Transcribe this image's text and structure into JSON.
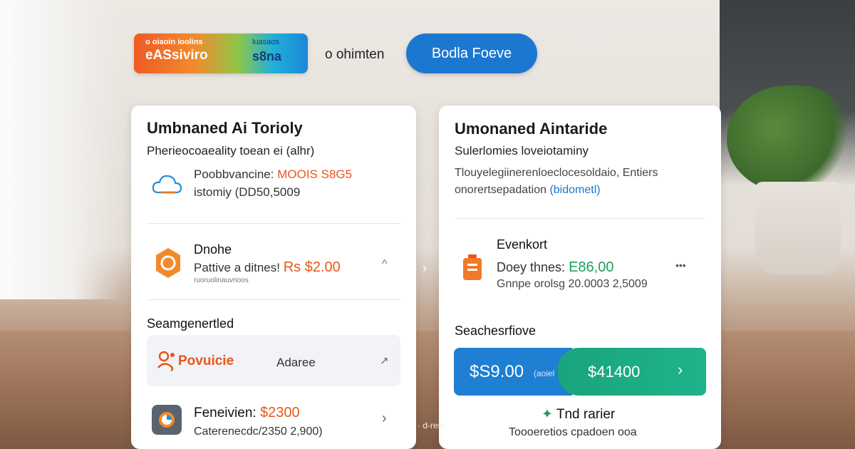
{
  "colors": {
    "brand_orange": "#ef5a24",
    "brand_blue": "#1b78d0",
    "accent_orange": "#e8561a",
    "accent_green": "#1e9e5a",
    "pay_blue": "#1e7fd3",
    "pay_green": "#1fb38a"
  },
  "header": {
    "brand_left_top": "o oiaoin ioolins",
    "brand_left_main": "eASsiviro",
    "brand_right_top": "luasaos",
    "brand_right_main": "s8na",
    "link_label": "o ohimten",
    "button_label": "Bodla Foeve"
  },
  "left_card": {
    "title": "Umbnaned Ai Torioly",
    "subtitle": "Pherieocoaeality toean ei (alhr)",
    "item1": {
      "icon": "cloud-icon",
      "line1_label": "Poobbvancine:",
      "line1_value": "MOOIS S8G5",
      "line2": "istomiy (DD50,5009"
    },
    "item2": {
      "icon": "orange-badge-icon",
      "title": "Dnohe",
      "label": "Pattive a ditnes!",
      "price": "Rs $2.00",
      "small": "ruoruolinauvrioos",
      "chevron": "^"
    },
    "section_title": "Seamgenertled",
    "promo": {
      "brand": "Povuicie",
      "label": "Adaree",
      "arrow": "↗"
    },
    "item3": {
      "icon": "app-icon",
      "title_label": "Feneivien:",
      "title_value": "$2300",
      "small": "Caterenecdc/2350 2,900)",
      "chevron": "›"
    }
  },
  "right_card": {
    "title": "Umonaned Aintaride",
    "subtitle": "Sulerlomies loveiotaminy",
    "desc_line1": "Tlouyelegiinerenloeclocesoldaio, Entiers",
    "desc_line2_prefix": "onorertsepadation",
    "desc_line2_link": "(bidometl)",
    "item1": {
      "icon": "battery-icon",
      "title": "Evenkort",
      "label": "Doey thnes:",
      "value": "E86,00",
      "small": "Gnnpe orolsg 20.0003 2,5009",
      "menu": "•••"
    },
    "section_title": "Seachesrfiove",
    "pay": {
      "left_amount": "$S9.00",
      "left_small": "(aoiel",
      "right_amount": "$41400",
      "chevron": "›"
    },
    "footer_title_prefix": "✦",
    "footer_title": "Tnd rarier",
    "footer_sub": "Toooeretios cpadoen ooa"
  },
  "floating": {
    "center_chevron": "›",
    "bottom_text": "· d-resr"
  }
}
